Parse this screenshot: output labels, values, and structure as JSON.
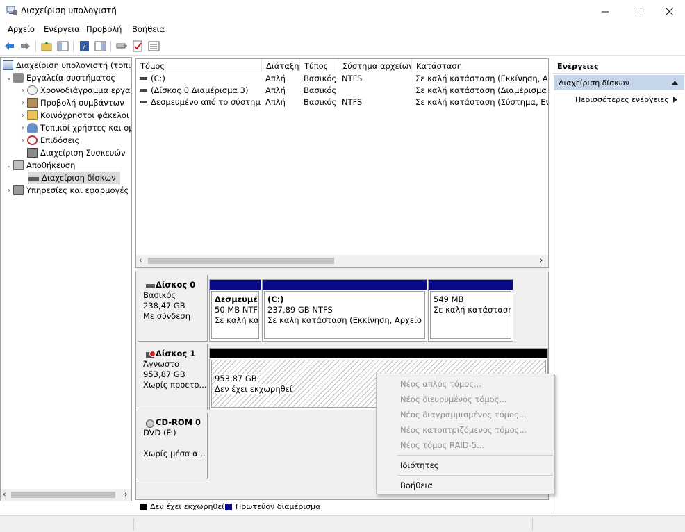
{
  "window": {
    "title": "Διαχείριση υπολογιστή"
  },
  "menu": [
    "Αρχείο",
    "Ενέργεια",
    "Προβολή",
    "Βοήθεια"
  ],
  "tree": {
    "root": "Διαχείριση υπολογιστή (τοπικ",
    "system_tools": "Εργαλεία συστήματος",
    "task_scheduler": "Χρονοδιάγραμμα εργασ",
    "event_viewer": "Προβολή συμβάντων",
    "shared_folders": "Κοινόχρηστοι φάκελοι",
    "local_users": "Τοπικοί χρήστες και ομ",
    "performance": "Επιδόσεις",
    "device_manager": "Διαχείριση Συσκευών",
    "storage": "Αποθήκευση",
    "disk_management": "Διαχείριση δίσκων",
    "services": "Υπηρεσίες και εφαρμογές"
  },
  "volume_list": {
    "columns": [
      "Τόμος",
      "Διάταξη",
      "Τύπος",
      "Σύστημα αρχείων",
      "Κατάσταση"
    ],
    "rows": [
      [
        "(C:)",
        "Απλή",
        "Βασικός",
        "NTFS",
        "Σε καλή κατάσταση (Εκκίνηση, Αρχε"
      ],
      [
        "(Δίσκος 0 Διαμέρισμα 3)",
        "Απλή",
        "Βασικός",
        "",
        "Σε καλή κατάσταση (Διαμέρισμα απ"
      ],
      [
        "Δεσμευμένο από το σύστημα",
        "Απλή",
        "Βασικός",
        "NTFS",
        "Σε καλή κατάσταση (Σύστημα, Ενεργ"
      ]
    ]
  },
  "disks": {
    "disk0": {
      "name": "Δίσκος 0",
      "type": "Βασικός",
      "size": "238,47 GB",
      "status": "Με σύνδεση"
    },
    "disk0_parts": [
      {
        "title": "Δεσμευμέ",
        "size": "50 MB NTFS",
        "status": "Σε καλή κατ"
      },
      {
        "title": "(C:)",
        "size": "237,89 GB NTFS",
        "status": "Σε καλή κατάσταση (Εκκίνηση, Αρχείο σελ"
      },
      {
        "title": "",
        "size": "549 MB",
        "status": "Σε καλή κατάσταση"
      }
    ],
    "disk1": {
      "name": "Δίσκος 1",
      "type": "Άγνωστο",
      "size": "953,87 GB",
      "status": "Χωρίς προετο..."
    },
    "disk1_part": {
      "size": "953,87 GB",
      "status": "Δεν έχει εκχωρηθεί"
    },
    "cdrom": {
      "name": "CD-ROM 0",
      "type": "DVD (F:)",
      "status": "Χωρίς μέσα α..."
    }
  },
  "legend": {
    "unallocated": "Δεν έχει εκχωρηθεί",
    "primary": "Πρωτεύον διαμέρισμα"
  },
  "actions": {
    "header": "Ενέργειες",
    "section": "Διαχείριση δίσκων",
    "more": "Περισσότερες ενέργειες"
  },
  "context_menu": {
    "simple": "Νέος απλός τόμος...",
    "spanned": "Νέος διευρυμένος τόμος...",
    "striped": "Νέος διαγραμμισμένος τόμος...",
    "mirrored": "Νέος κατοπτριζόμενος τόμος...",
    "raid5": "Νέος τόμος RAID-5...",
    "properties": "Ιδιότητες",
    "help": "Βοήθεια"
  },
  "colors": {
    "primary_partition": "#0a0a88",
    "unallocated": "#000000",
    "selection": "#c5d6ea"
  }
}
